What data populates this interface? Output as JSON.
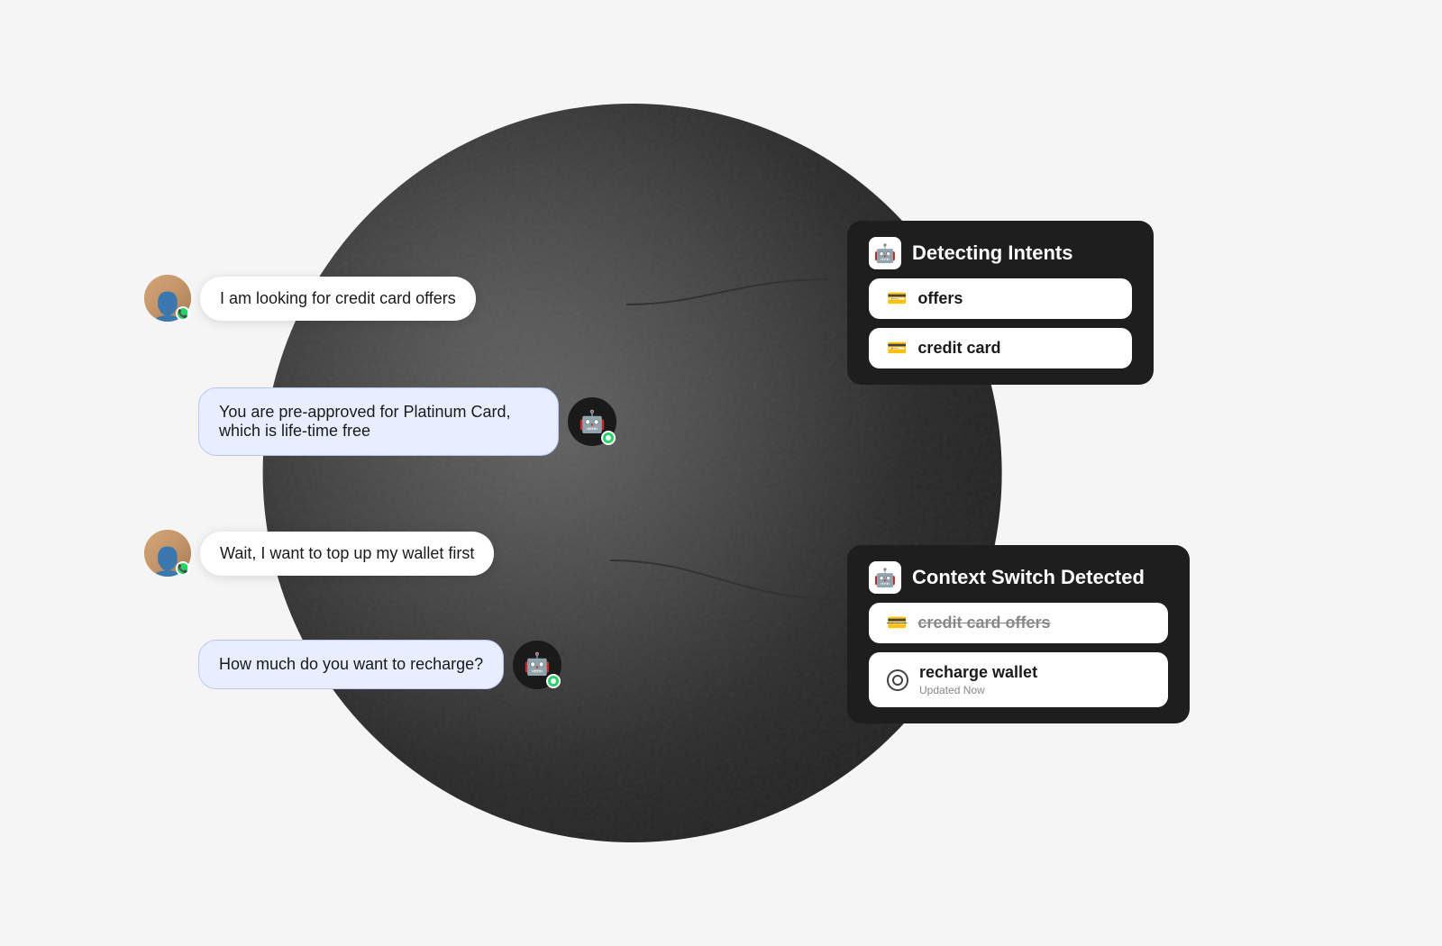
{
  "scene": {
    "background_circle": true
  },
  "messages": [
    {
      "id": "msg1",
      "type": "user",
      "text": "I am looking for credit card offers"
    },
    {
      "id": "msg2",
      "type": "bot",
      "text": "You are pre-approved for Platinum Card, which is life-time free"
    },
    {
      "id": "msg3",
      "type": "user",
      "text": "Wait, I want to top up my wallet first"
    },
    {
      "id": "msg4",
      "type": "bot",
      "text": "How much do you want to recharge?"
    }
  ],
  "panels": [
    {
      "id": "panel1",
      "title": "Detecting Intents",
      "intents": [
        {
          "label": "offers",
          "type": "card",
          "strikethrough": false
        },
        {
          "label": "credit card",
          "type": "card",
          "strikethrough": false
        }
      ]
    },
    {
      "id": "panel2",
      "title": "Context Switch Detected",
      "intents": [
        {
          "label": "credit card offers",
          "type": "card",
          "strikethrough": true
        },
        {
          "label": "recharge wallet",
          "type": "wallet",
          "strikethrough": false,
          "subtitle": "Updated Now"
        }
      ]
    }
  ],
  "icons": {
    "bot": "🤖",
    "card": "💳",
    "wallet": "⊙",
    "user": "👤",
    "phone": "📞"
  }
}
